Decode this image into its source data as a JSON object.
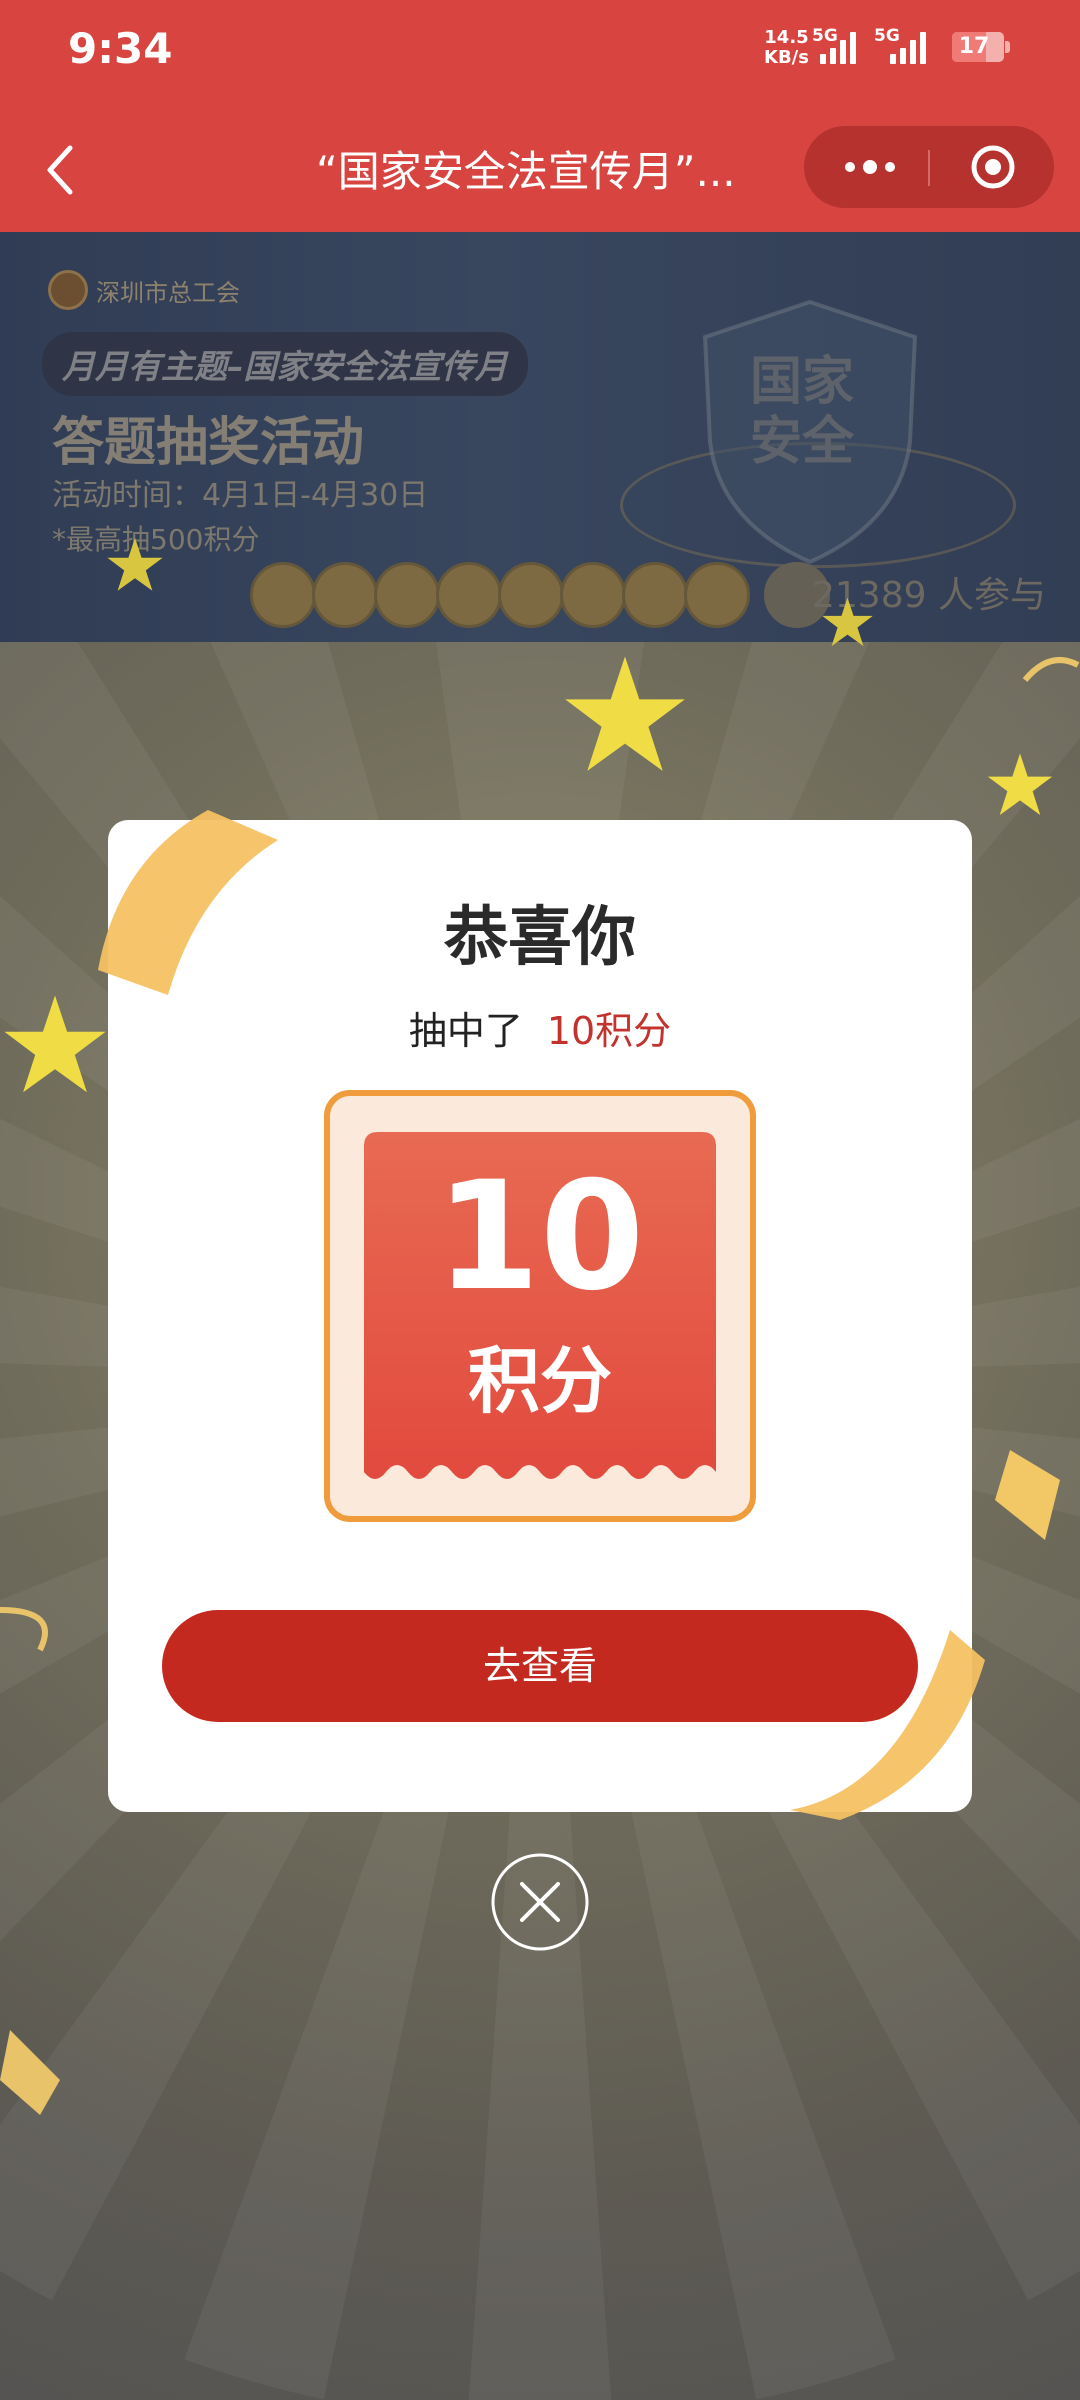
{
  "status_bar": {
    "time": "9:34",
    "net_speed_value": "14.5",
    "net_speed_unit": "KB/s",
    "sim1": "5G",
    "sim2": "5G",
    "battery": "17"
  },
  "nav": {
    "title": "“国家安全法宣传月”...",
    "more_icon": "more-dots-icon",
    "target_icon": "target-icon",
    "back_icon": "back-chevron-icon"
  },
  "banner": {
    "org": "深圳市总工会",
    "theme": "月月有主题–国家安全法宣传月",
    "headline": "答题抽奖活动",
    "time": "活动时间：4月1日-4月30日",
    "max_prize": "*最高抽500积分",
    "shield_text": "国家安全",
    "participants": "21389 人参与"
  },
  "modal": {
    "title": "恭喜你",
    "subtitle_prefix": "抽中了",
    "subtitle_prize": "10积分",
    "ticket_number": "10",
    "ticket_unit": "积分",
    "action_button": "去查看",
    "close_icon": "close-icon"
  },
  "colors": {
    "header": "#d84440",
    "accent": "#c3291f",
    "ticket_border": "#f09b3c"
  }
}
